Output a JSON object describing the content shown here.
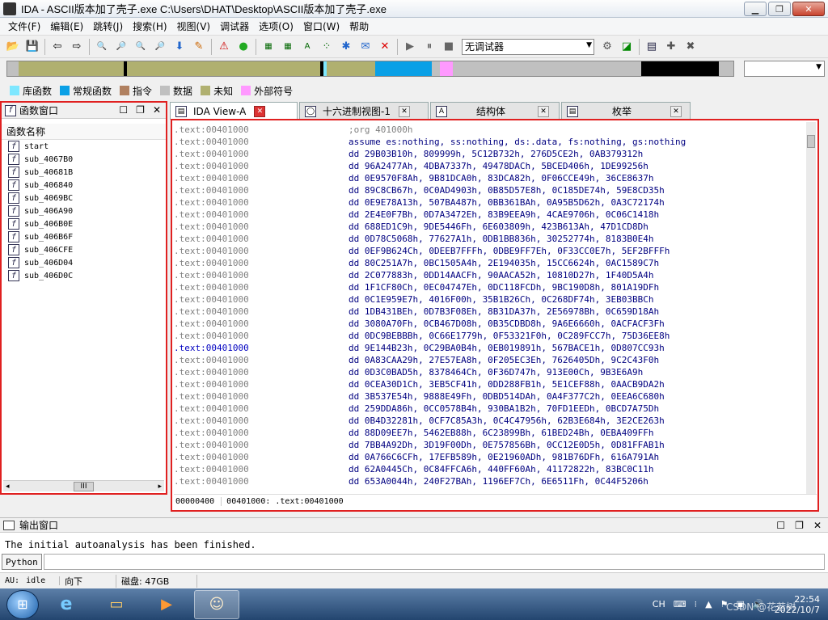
{
  "title": "IDA - ASCII版本加了壳子.exe C:\\Users\\DHAT\\Desktop\\ASCII版本加了壳子.exe",
  "window_buttons": {
    "minimize": "▁",
    "restore": "❐",
    "close": "✕"
  },
  "menu": [
    "文件(F)",
    "编辑(E)",
    "跳转(J)",
    "搜索(H)",
    "视图(V)",
    "调试器",
    "选项(O)",
    "窗口(W)",
    "帮助"
  ],
  "toolbar": {
    "debugger_select": "无调试器",
    "icons_left": [
      "open-icon",
      "save-icon",
      "back-icon",
      "forward-icon",
      "search-icon",
      "search-binary-icon",
      "search-text-icon",
      "search-next-icon",
      "jump-icon",
      "mark-icon"
    ],
    "icons_right": [
      "play-icon",
      "pause-icon",
      "stop-icon",
      "help-icon",
      "graph-icon",
      "plugin-icon"
    ]
  },
  "legend": [
    {
      "label": "库函数",
      "color": "#7ee7ff"
    },
    {
      "label": "常规函数",
      "color": "#0aa0e6"
    },
    {
      "label": "指令",
      "color": "#b08060"
    },
    {
      "label": "数据",
      "color": "#c0c0c0"
    },
    {
      "label": "未知",
      "color": "#b0b070"
    },
    {
      "label": "外部符号",
      "color": "#ff99ff"
    }
  ],
  "nav_band": [
    {
      "color": "#c0c0c0",
      "w": 14
    },
    {
      "color": "#b0b070",
      "w": 130
    },
    {
      "color": "#000000",
      "w": 4
    },
    {
      "color": "#b0b070",
      "w": 240
    },
    {
      "color": "#000000",
      "w": 4
    },
    {
      "color": "#7ee7ff",
      "w": 4
    },
    {
      "color": "#b0b070",
      "w": 60
    },
    {
      "color": "#0aa0e6",
      "w": 70
    },
    {
      "color": "#c0c0c0",
      "w": 10
    },
    {
      "color": "#ff99ff",
      "w": 16
    },
    {
      "color": "#c0c0c0",
      "w": 116
    },
    {
      "color": "#c0c0c0",
      "w": 118
    },
    {
      "color": "#000000",
      "w": 96
    },
    {
      "color": "#c0c0c0",
      "w": 18
    }
  ],
  "function_window": {
    "title": "函数窗口",
    "column_header": "函数名称",
    "functions": [
      "start",
      "sub_4067B0",
      "sub_40681B",
      "sub_406840",
      "sub_4069BC",
      "sub_406A90",
      "sub_406B0E",
      "sub_406B6F",
      "sub_406CFE",
      "sub_406D04",
      "sub_406D0C"
    ]
  },
  "tabs": [
    {
      "label": "IDA View-A",
      "active": true
    },
    {
      "label": "十六进制视图-1",
      "active": false
    },
    {
      "label": "结构体",
      "active": false
    },
    {
      "label": "枚举",
      "active": false
    }
  ],
  "ida_view": {
    "lines": [
      {
        "addr": ".text:00401000",
        "text": ";org 401000h",
        "type": "comment"
      },
      {
        "addr": ".text:00401000",
        "text": "assume es:nothing, ss:nothing, ds:.data, fs:nothing, gs:nothing",
        "type": "ins"
      },
      {
        "addr": ".text:00401000",
        "text": "dd 29B03B10h, 809999h, 5C12B732h, 276D5CE2h, 0AB379312h",
        "type": "ins"
      },
      {
        "addr": ".text:00401000",
        "text": "dd 96A2477Ah, 4DBA7337h, 49478DACh, 5BCED406h, 1DE99256h",
        "type": "ins"
      },
      {
        "addr": ".text:00401000",
        "text": "dd 0E9570F8Ah, 9B81DCA0h, 83DCA82h, 0F06CCE49h, 36CE8637h",
        "type": "ins"
      },
      {
        "addr": ".text:00401000",
        "text": "dd 89C8CB67h, 0C0AD4903h, 0B85D57E8h, 0C185DE74h, 59E8CD35h",
        "type": "ins"
      },
      {
        "addr": ".text:00401000",
        "text": "dd 0E9E78A13h, 507BA487h, 0BB361BAh, 0A95B5D62h, 0A3C72174h",
        "type": "ins"
      },
      {
        "addr": ".text:00401000",
        "text": "dd 2E4E0F7Bh, 0D7A3472Eh, 83B9EEA9h, 4CAE9706h, 0C06C1418h",
        "type": "ins"
      },
      {
        "addr": ".text:00401000",
        "text": "dd 688ED1C9h, 9DE5446Fh, 6E603809h, 423B613Ah, 47D1CD8Dh",
        "type": "ins"
      },
      {
        "addr": ".text:00401000",
        "text": "dd 0D78C5068h, 77627A1h, 0DB1BB836h, 30252774h, 8183B0E4h",
        "type": "ins"
      },
      {
        "addr": ".text:00401000",
        "text": "dd 0EF9B624Ch, 0DEEB7FFFh, 0DBE9FF7Eh, 0F33CC0E7h, 5EF2BFFFh",
        "type": "ins"
      },
      {
        "addr": ".text:00401000",
        "text": "dd 80C251A7h, 0BC1505A4h, 2E194035h, 15CC6624h, 0AC1589C7h",
        "type": "ins"
      },
      {
        "addr": ".text:00401000",
        "text": "dd 2C077883h, 0DD14AACFh, 90AACA52h, 10810D27h, 1F40D5A4h",
        "type": "ins"
      },
      {
        "addr": ".text:00401000",
        "text": "dd 1F1CF80Ch, 0EC04747Eh, 0DC118FCDh, 9BC190D8h, 801A19DFh",
        "type": "ins"
      },
      {
        "addr": ".text:00401000",
        "text": "dd 0C1E959E7h, 4016F00h, 35B1B26Ch, 0C268DF74h, 3EB03BBCh",
        "type": "ins"
      },
      {
        "addr": ".text:00401000",
        "text": "dd 1DB431BEh, 0D7B3F08Eh, 8B31DA37h, 2E56978Bh, 0C659D18Ah",
        "type": "ins"
      },
      {
        "addr": ".text:00401000",
        "text": "dd 3080A70Fh, 0CB467D08h, 0B35CDBD8h, 9A6E6660h, 0ACFACF3Fh",
        "type": "ins"
      },
      {
        "addr": ".text:00401000",
        "text": "dd 0DC9BEBBBh, 0C66E1779h, 0F53321F0h, 0C289FCC7h, 75D36EE8h",
        "type": "ins"
      },
      {
        "addr": ".text:00401000",
        "text": "dd 9E144B23h, 0C29BA0B4h, 0EB019891h, 567BACE1h, 0D807CC93h",
        "type": "ins",
        "highlight": true
      },
      {
        "addr": ".text:00401000",
        "text": "dd 0A83CAA29h, 27E57EA8h, 0F205EC3Eh, 7626405Dh, 9C2C43F0h",
        "type": "ins"
      },
      {
        "addr": ".text:00401000",
        "text": "dd 0D3C0BAD5h, 8378464Ch, 0F36D747h, 913E00Ch, 9B3E6A9h",
        "type": "ins"
      },
      {
        "addr": ".text:00401000",
        "text": "dd 0CEA30D1Ch, 3EB5CF41h, 0DD288FB1h, 5E1CEF88h, 0AACB9DA2h",
        "type": "ins"
      },
      {
        "addr": ".text:00401000",
        "text": "dd 3B537E54h, 9888E49Fh, 0DBD514DAh, 0A4F377C2h, 0EEA6C680h",
        "type": "ins"
      },
      {
        "addr": ".text:00401000",
        "text": "dd 259DDA86h, 0CC0578B4h, 930BA1B2h, 70FD1EEDh, 0BCD7A75Dh",
        "type": "ins"
      },
      {
        "addr": ".text:00401000",
        "text": "dd 0B4D32281h, 0CF7C85A3h, 0C4C47956h, 62B3E684h, 3E2CE263h",
        "type": "ins"
      },
      {
        "addr": ".text:00401000",
        "text": "dd 88D09EE7h, 5462EB88h, 6C23899Bh, 61BED24Bh, 0EBA409FFh",
        "type": "ins"
      },
      {
        "addr": ".text:00401000",
        "text": "dd 7BB4A92Dh, 3D19F00Dh, 0E757856Bh, 0CC12E0D5h, 0D81FFAB1h",
        "type": "ins"
      },
      {
        "addr": ".text:00401000",
        "text": "dd 0A766C6CFh, 17EFB589h, 0E21960ADh, 981B76DFh, 616A791Ah",
        "type": "ins"
      },
      {
        "addr": ".text:00401000",
        "text": "dd 62A0445Ch, 0C84FFCA6h, 440FF60Ah, 41172822h, 83BC0C11h",
        "type": "ins"
      },
      {
        "addr": ".text:00401000",
        "text": "dd 653A0044h, 240F27BAh, 1196EF7Ch, 6E6511Fh, 0C44F5206h",
        "type": "ins"
      }
    ],
    "status": [
      "00000400",
      "00401000: .text:00401000"
    ]
  },
  "output_window": {
    "title": "输出窗口",
    "text": "The initial autoanalysis has been finished.",
    "python_button": "Python"
  },
  "statusbar": {
    "au": "AU:",
    "state": "idle",
    "direction": "向下",
    "disk": "磁盘: 47GB"
  },
  "taskbar": {
    "tray_lang": "CH",
    "time": "22:54",
    "date": "2022/10/7",
    "watermark": "CSDN @花若树"
  }
}
